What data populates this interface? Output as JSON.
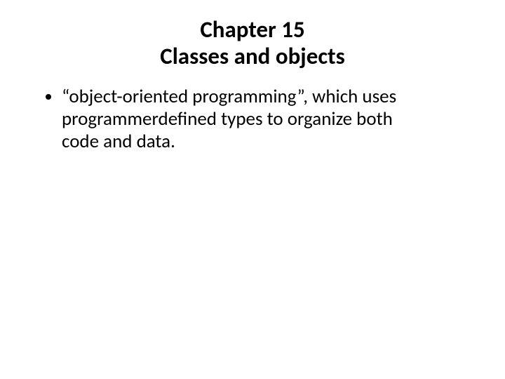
{
  "title": {
    "line1": "Chapter 15",
    "line2": "Classes and objects"
  },
  "bullets": [
    "“object-oriented programming”, which uses programmerdefined types to organize both code and data."
  ]
}
